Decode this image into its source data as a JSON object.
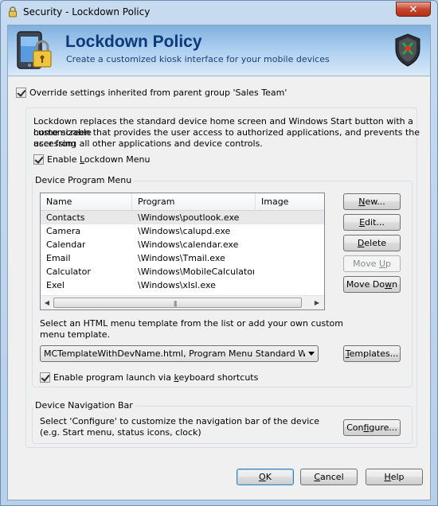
{
  "window": {
    "title": "Security - Lockdown Policy",
    "close_glyph": "✕"
  },
  "banner": {
    "title": "Lockdown Policy",
    "subtitle": "Create a customized kiosk interface for your mobile devices",
    "icon": "device-lock-icon",
    "badge_icon": "shield-icon"
  },
  "override": {
    "label": "Override settings inherited from parent group 'Sales Team'",
    "checked": true
  },
  "description": {
    "line1": "Lockdown replaces the standard device home screen and Windows Start button with a customizable",
    "line2": "home screen that provides the user access to authorized applications, and prevents the user from",
    "line3": "accessing all other applications and device controls."
  },
  "enable_lockdown": {
    "label_pre": "Enable ",
    "label_ul": "L",
    "label_post": "ockdown Menu",
    "checked": true
  },
  "program_menu": {
    "group_label": "Device Program Menu",
    "columns": [
      "Name",
      "Program",
      "Image"
    ],
    "rows": [
      {
        "name": "Contacts",
        "program": "\\Windows\\poutlook.exe",
        "image": ""
      },
      {
        "name": "Camera",
        "program": "\\Windows\\calupd.exe",
        "image": ""
      },
      {
        "name": "Calendar",
        "program": "\\Windows\\calendar.exe",
        "image": ""
      },
      {
        "name": "Email",
        "program": "\\Windows\\Tmail.exe",
        "image": ""
      },
      {
        "name": "Calculator",
        "program": "\\Windows\\MobileCalculator...",
        "image": ""
      },
      {
        "name": "Exel",
        "program": "\\Windows\\xlsl.exe",
        "image": ""
      }
    ],
    "buttons": {
      "new": {
        "pre": "",
        "ul": "N",
        "post": "ew..."
      },
      "edit": {
        "pre": "",
        "ul": "E",
        "post": "dit..."
      },
      "delete": {
        "pre": "",
        "ul": "D",
        "post": "elete"
      },
      "move_up": {
        "pre": "Move ",
        "ul": "U",
        "post": "p"
      },
      "move_down": {
        "pre": "Move Do",
        "ul": "w",
        "post": "n"
      }
    },
    "template_text_line1": "Select an HTML menu template from the list or add your own custom",
    "template_text_line2": "menu template.",
    "template_selected": "MCTemplateWithDevName.html, Program Menu Standard With Device Name",
    "templates_button": {
      "pre": "",
      "ul": "T",
      "post": "emplates..."
    },
    "keyboard_shortcuts": {
      "label_pre": "Enable program launch via ",
      "label_ul": "k",
      "label_post": "eyboard shortcuts",
      "checked": true
    }
  },
  "nav_bar": {
    "group_label": "Device Navigation Bar",
    "text_line1": "Select 'Configure' to customize the navigation bar of the device",
    "text_line2": "(e.g. Start menu, status icons, clock)",
    "configure_button": {
      "pre": "Con",
      "ul": "f",
      "post": "igure..."
    }
  },
  "dialog_buttons": {
    "ok": {
      "pre": "",
      "ul": "O",
      "post": "K"
    },
    "cancel": {
      "pre": "",
      "ul": "C",
      "post": "ancel"
    },
    "help": {
      "pre": "",
      "ul": "H",
      "post": "elp"
    }
  }
}
